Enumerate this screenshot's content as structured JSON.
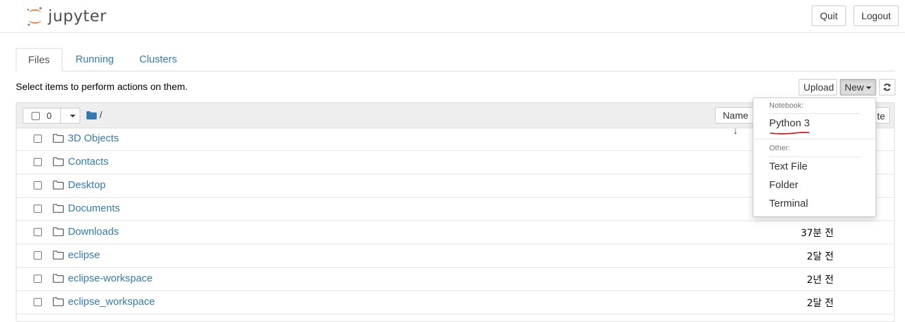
{
  "header": {
    "logo_text": "jupyter",
    "quit_label": "Quit",
    "logout_label": "Logout"
  },
  "tabs": [
    {
      "label": "Files",
      "active": true
    },
    {
      "label": "Running",
      "active": false
    },
    {
      "label": "Clusters",
      "active": false
    }
  ],
  "toolbar": {
    "hint": "Select items to perform actions on them.",
    "upload_label": "Upload",
    "new_label": "New",
    "refresh_icon": "refresh-icon"
  },
  "list_header": {
    "selected_count": "0",
    "breadcrumb": "/",
    "sort_name_label": "Name",
    "last_modified_label": "te"
  },
  "rows": [
    {
      "name": "3D Objects",
      "time": ""
    },
    {
      "name": "Contacts",
      "time": ""
    },
    {
      "name": "Desktop",
      "time": ""
    },
    {
      "name": "Documents",
      "time": ""
    },
    {
      "name": "Downloads",
      "time": "37분 전"
    },
    {
      "name": "eclipse",
      "time": "2달 전"
    },
    {
      "name": "eclipse-workspace",
      "time": "2년 전"
    },
    {
      "name": "eclipse_workspace",
      "time": "2달 전"
    }
  ],
  "new_menu": {
    "notebook_header": "Notebook:",
    "python3": "Python 3",
    "other_header": "Other:",
    "text_file": "Text File",
    "folder": "Folder",
    "terminal": "Terminal"
  },
  "colors": {
    "link": "#337ab7",
    "logo_orange": "#f37726",
    "annotation_red": "#e00000"
  }
}
